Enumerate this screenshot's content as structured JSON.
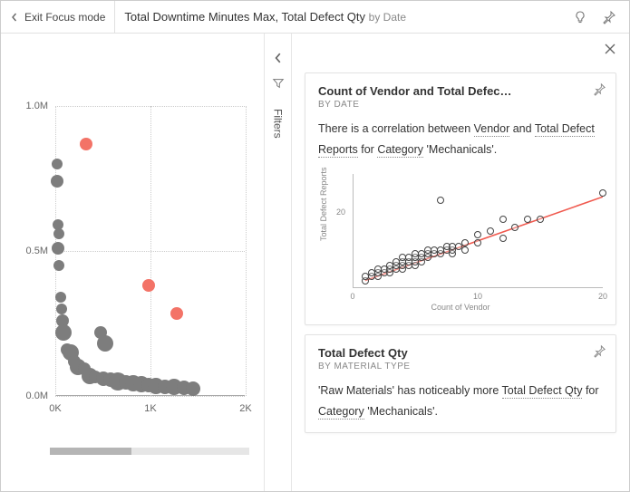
{
  "header": {
    "exit_label": "Exit Focus mode",
    "title_main": "Total Downtime Minutes Max, Total Defect Qty",
    "title_by": "by Date"
  },
  "filters": {
    "label": "Filters"
  },
  "chart_data": {
    "left_scatter": {
      "type": "scatter",
      "y_ticks": [
        "0.0M",
        "0.5M",
        "1.0M"
      ],
      "x_ticks": [
        "0K",
        "1K",
        "2K"
      ],
      "y_range": [
        0,
        1000000
      ],
      "x_range": [
        0,
        2000
      ],
      "points_gray": [
        {
          "x": 20,
          "y": 800000,
          "r": 6
        },
        {
          "x": 20,
          "y": 740000,
          "r": 7
        },
        {
          "x": 25,
          "y": 590000,
          "r": 6
        },
        {
          "x": 30,
          "y": 510000,
          "r": 7
        },
        {
          "x": 35,
          "y": 560000,
          "r": 6
        },
        {
          "x": 40,
          "y": 450000,
          "r": 6
        },
        {
          "x": 60,
          "y": 340000,
          "r": 6
        },
        {
          "x": 70,
          "y": 300000,
          "r": 6
        },
        {
          "x": 80,
          "y": 260000,
          "r": 7
        },
        {
          "x": 90,
          "y": 220000,
          "r": 9
        },
        {
          "x": 480,
          "y": 220000,
          "r": 7
        },
        {
          "x": 520,
          "y": 180000,
          "r": 9
        },
        {
          "x": 120,
          "y": 160000,
          "r": 7
        },
        {
          "x": 160,
          "y": 150000,
          "r": 9
        },
        {
          "x": 200,
          "y": 120000,
          "r": 7
        },
        {
          "x": 240,
          "y": 100000,
          "r": 9
        },
        {
          "x": 300,
          "y": 95000,
          "r": 7
        },
        {
          "x": 360,
          "y": 70000,
          "r": 9
        },
        {
          "x": 420,
          "y": 65000,
          "r": 7
        },
        {
          "x": 500,
          "y": 60000,
          "r": 8
        },
        {
          "x": 580,
          "y": 55000,
          "r": 8
        },
        {
          "x": 660,
          "y": 50000,
          "r": 10
        },
        {
          "x": 740,
          "y": 48000,
          "r": 8
        },
        {
          "x": 820,
          "y": 45000,
          "r": 9
        },
        {
          "x": 900,
          "y": 42000,
          "r": 9
        },
        {
          "x": 980,
          "y": 38000,
          "r": 8
        },
        {
          "x": 1060,
          "y": 35000,
          "r": 9
        },
        {
          "x": 1150,
          "y": 32000,
          "r": 8
        },
        {
          "x": 1250,
          "y": 30000,
          "r": 9
        },
        {
          "x": 1350,
          "y": 28000,
          "r": 8
        },
        {
          "x": 1450,
          "y": 25000,
          "r": 8
        }
      ],
      "points_red": [
        {
          "x": 320,
          "y": 870000,
          "r": 7
        },
        {
          "x": 980,
          "y": 380000,
          "r": 7
        },
        {
          "x": 1280,
          "y": 285000,
          "r": 7
        }
      ]
    },
    "insight_scatter": {
      "type": "scatter",
      "xlabel": "Count of Vendor",
      "ylabel": "Total Defect Reports",
      "x_range": [
        0,
        20
      ],
      "y_range": [
        0,
        30
      ],
      "x_ticks": [
        0,
        10,
        20
      ],
      "y_ticks": [
        20
      ],
      "trend_line": {
        "x1": 1,
        "y1": 2,
        "x2": 20,
        "y2": 24
      },
      "points": [
        {
          "x": 1,
          "y": 2
        },
        {
          "x": 1,
          "y": 3
        },
        {
          "x": 1.5,
          "y": 3
        },
        {
          "x": 1.5,
          "y": 4
        },
        {
          "x": 2,
          "y": 3
        },
        {
          "x": 2,
          "y": 4
        },
        {
          "x": 2,
          "y": 5
        },
        {
          "x": 2.5,
          "y": 4
        },
        {
          "x": 2.5,
          "y": 5
        },
        {
          "x": 3,
          "y": 4
        },
        {
          "x": 3,
          "y": 5
        },
        {
          "x": 3,
          "y": 6
        },
        {
          "x": 3.5,
          "y": 5
        },
        {
          "x": 3.5,
          "y": 6
        },
        {
          "x": 3.5,
          "y": 7
        },
        {
          "x": 4,
          "y": 5
        },
        {
          "x": 4,
          "y": 6
        },
        {
          "x": 4,
          "y": 7
        },
        {
          "x": 4,
          "y": 8
        },
        {
          "x": 4.5,
          "y": 6
        },
        {
          "x": 4.5,
          "y": 7
        },
        {
          "x": 4.5,
          "y": 8
        },
        {
          "x": 5,
          "y": 6
        },
        {
          "x": 5,
          "y": 7
        },
        {
          "x": 5,
          "y": 8
        },
        {
          "x": 5,
          "y": 9
        },
        {
          "x": 5.5,
          "y": 7
        },
        {
          "x": 5.5,
          "y": 8
        },
        {
          "x": 5.5,
          "y": 9
        },
        {
          "x": 6,
          "y": 8
        },
        {
          "x": 6,
          "y": 9
        },
        {
          "x": 6,
          "y": 10
        },
        {
          "x": 6.5,
          "y": 9
        },
        {
          "x": 6.5,
          "y": 10
        },
        {
          "x": 7,
          "y": 9
        },
        {
          "x": 7,
          "y": 10
        },
        {
          "x": 7,
          "y": 23
        },
        {
          "x": 7.5,
          "y": 10
        },
        {
          "x": 7.5,
          "y": 11
        },
        {
          "x": 8,
          "y": 9
        },
        {
          "x": 8,
          "y": 10
        },
        {
          "x": 8,
          "y": 11
        },
        {
          "x": 8.5,
          "y": 11
        },
        {
          "x": 9,
          "y": 10
        },
        {
          "x": 9,
          "y": 12
        },
        {
          "x": 10,
          "y": 12
        },
        {
          "x": 10,
          "y": 14
        },
        {
          "x": 11,
          "y": 15
        },
        {
          "x": 12,
          "y": 13
        },
        {
          "x": 12,
          "y": 18
        },
        {
          "x": 13,
          "y": 16
        },
        {
          "x": 14,
          "y": 18
        },
        {
          "x": 15,
          "y": 18
        },
        {
          "x": 20,
          "y": 25
        }
      ]
    }
  },
  "insights": [
    {
      "title": "Count of Vendor and Total Defec…",
      "subtitle": "BY DATE",
      "text_parts": {
        "t1": "There is a correlation between ",
        "u1": "Vendor",
        "t2": " and ",
        "u2": "Total Defect Reports",
        "t3": " for ",
        "u3": "Category",
        "t4": " 'Mechanicals'."
      }
    },
    {
      "title": "Total Defect Qty",
      "subtitle": "BY MATERIAL TYPE",
      "text_parts": {
        "t1": "'Raw Materials' has noticeably more ",
        "u1": "Total Defect Qty",
        "t2": " for ",
        "u2": "Category",
        "t3": " 'Mechanicals'.",
        "u3": "",
        "t4": ""
      }
    }
  ]
}
